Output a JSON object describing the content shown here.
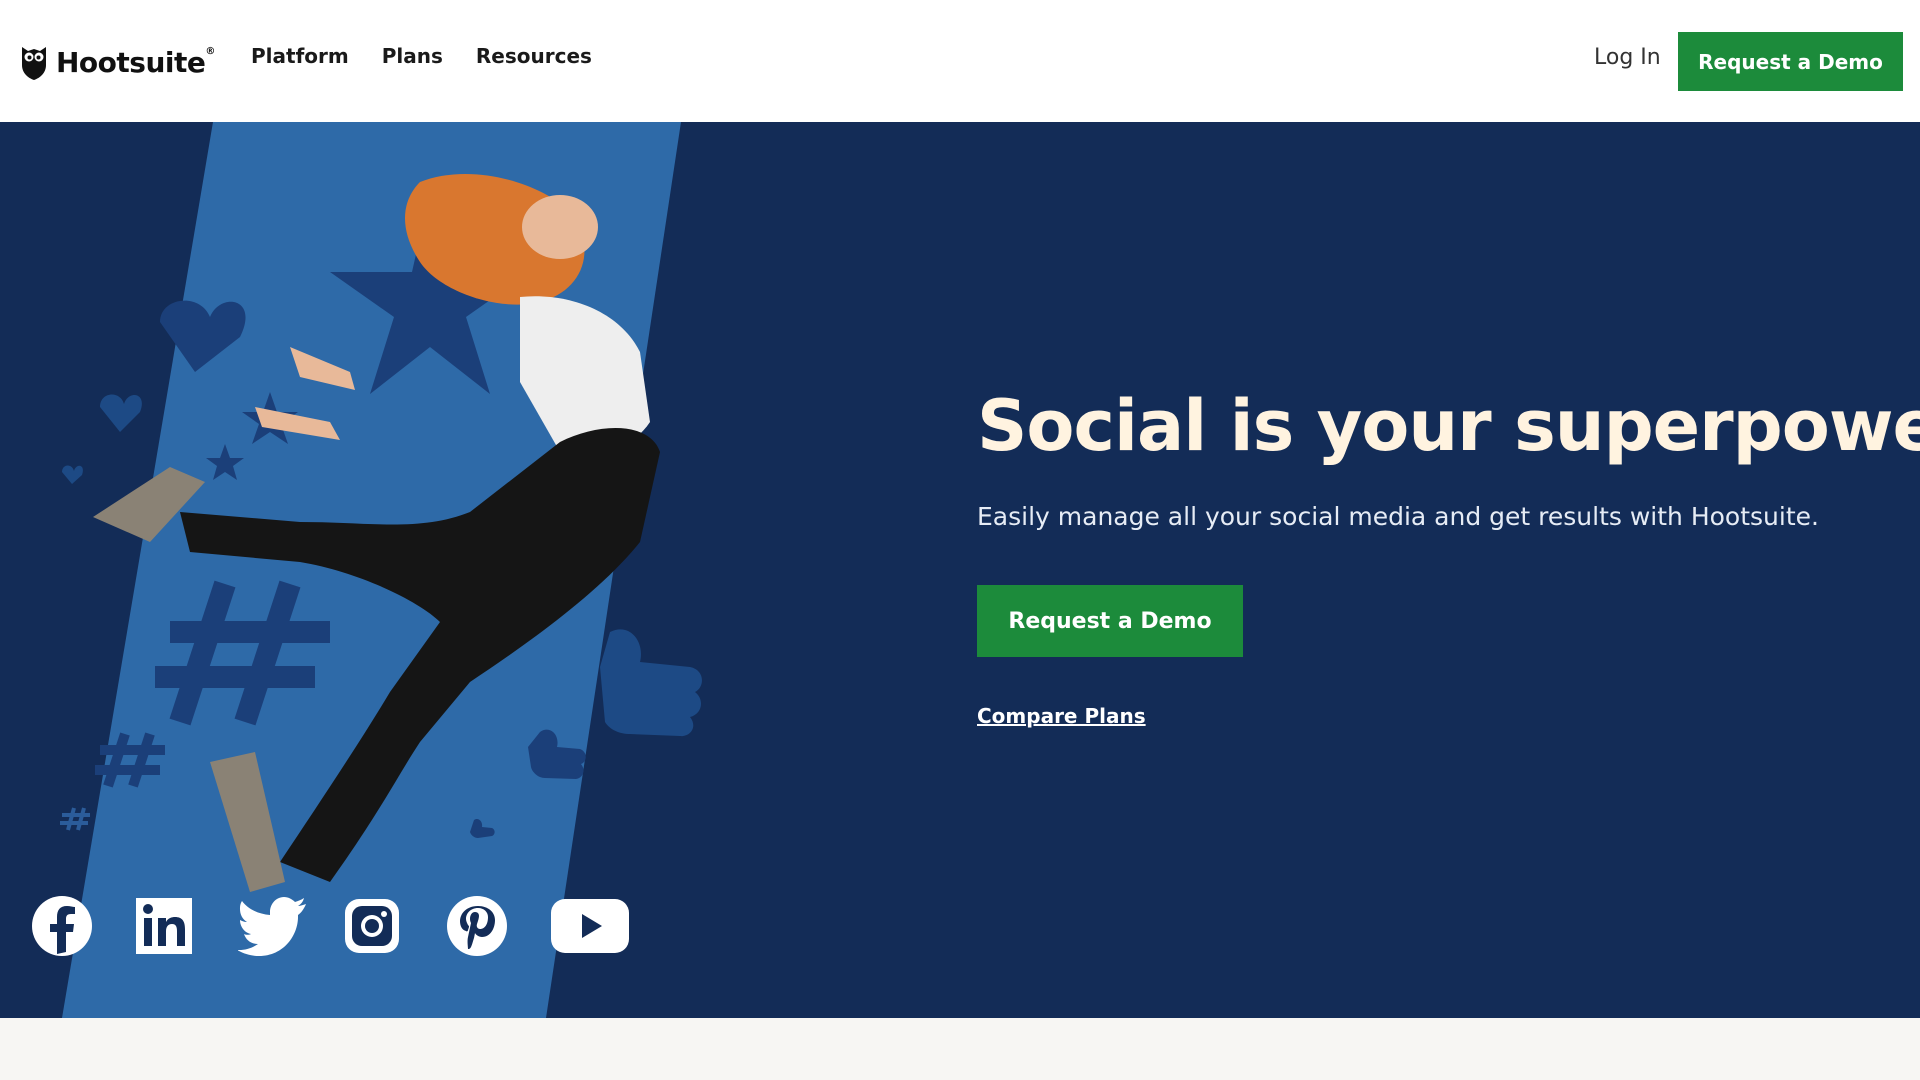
{
  "header": {
    "logo_text": "Hootsuite",
    "logo_reg": "®",
    "nav": [
      "Platform",
      "Plans",
      "Resources"
    ],
    "login_label": "Log In",
    "cta_label": "Request a Demo"
  },
  "hero": {
    "headline": "Social is your superpower.",
    "subtext": "Easily manage all your social media and get results with Hootsuite.",
    "cta_label": "Request a Demo",
    "link_label": "Compare Plans",
    "social_icons": [
      "facebook-icon",
      "linkedin-icon",
      "twitter-icon",
      "instagram-icon",
      "pinterest-icon",
      "youtube-icon"
    ]
  },
  "colors": {
    "hero_bg": "#132c57",
    "stripe": "#2e6aa8",
    "brand_green": "#1c8b3b",
    "headline": "#fff3e0"
  }
}
